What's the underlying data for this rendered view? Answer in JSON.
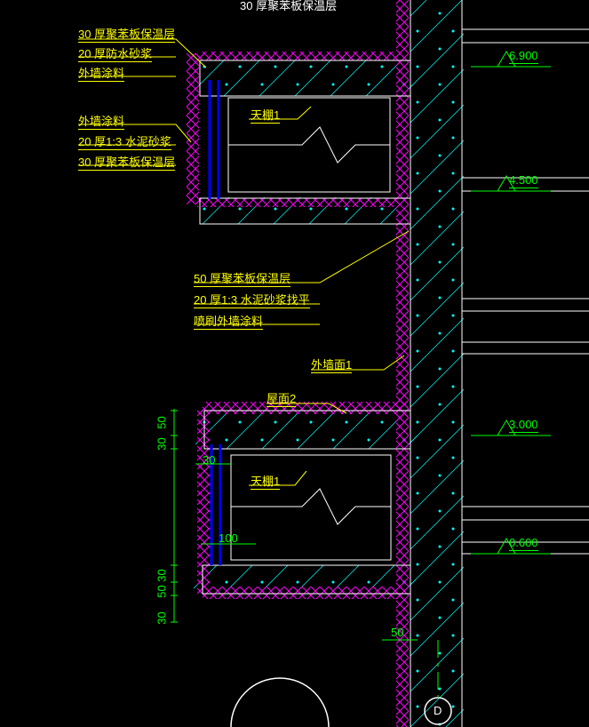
{
  "annotations": {
    "top_partial": "30 厚聚苯板保温层",
    "group1": {
      "l1": "30 厚聚苯板保温层",
      "l2": "20 厚防水砂浆",
      "l3": "外墙涂料"
    },
    "group2": {
      "l1": "外墙涂料",
      "l2": "20 厚1:3 水泥砂浆",
      "l3": "30 厚聚苯板保温层"
    },
    "group3": {
      "l1": "50 厚聚苯板保温层",
      "l2": "20 厚1:3 水泥砂浆找平",
      "l3": "喷刷外墙涂料"
    },
    "wall_label": "外墙面1",
    "roof_label": "屋面2",
    "ceiling_label": "天棚1"
  },
  "dims": {
    "d30": "30",
    "d50": "50",
    "d100": "100"
  },
  "elevations": {
    "e1": "6.900",
    "e2": "4.500",
    "e3": "3.000",
    "e4": "0.600"
  },
  "grid": {
    "d": "D"
  },
  "colors": {
    "magenta": "#ff00ff",
    "cyan": "#00ffff",
    "yellow": "#ffff00",
    "white": "#ffffff",
    "green": "#00ff00",
    "blue": "#0000ff"
  }
}
